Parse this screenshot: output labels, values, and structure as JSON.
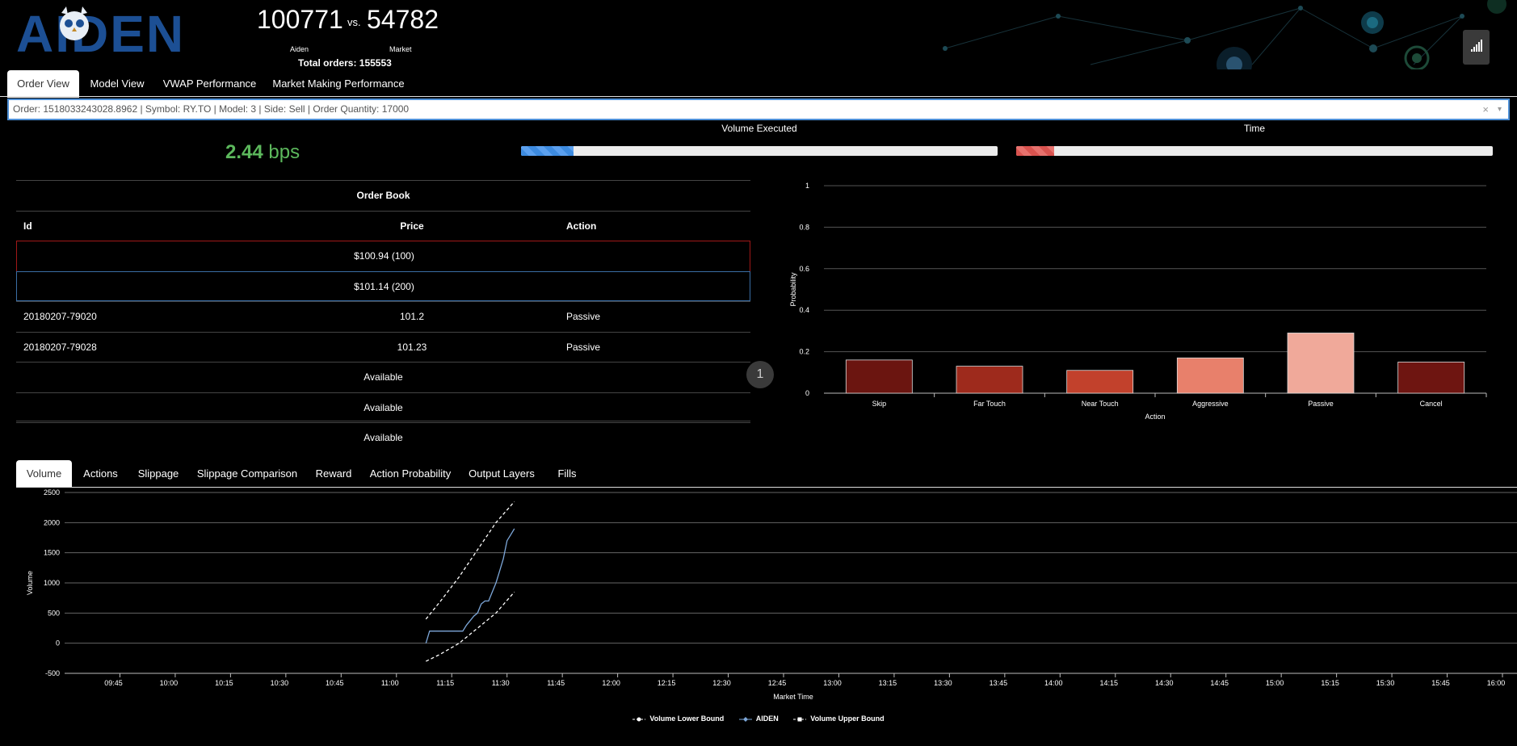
{
  "header": {
    "logo_text": "AIDEN",
    "aiden_score": "100771",
    "vs_label": "vs.",
    "market_score": "54782",
    "aiden_label": "Aiden",
    "market_label": "Market",
    "total_orders_label": "Total orders: 155553",
    "signal_icon": "signal-bars-icon"
  },
  "tabs": [
    {
      "label": "Order View",
      "active": true
    },
    {
      "label": "Model View",
      "active": false
    },
    {
      "label": "VWAP Performance",
      "active": false
    },
    {
      "label": "Market Making Performance",
      "active": false
    }
  ],
  "order_select": {
    "value": "Order: 1518033243028.8962 | Symbol: RY.TO | Model: 3 | Side: Sell | Order Quantity: 17000",
    "clear": "×",
    "caret": "▾"
  },
  "progress": {
    "volume_label": "Volume Executed",
    "volume_fraction": 0.11,
    "time_label": "Time",
    "time_fraction": 0.08
  },
  "bps": {
    "value": "2.44",
    "unit": "bps"
  },
  "order_book": {
    "title": "Order Book",
    "headers": {
      "id": "Id",
      "price": "Price",
      "action": "Action"
    },
    "ask": "$100.94 (100)",
    "bid": "$101.14 (200)",
    "rows": [
      {
        "id": "20180207-79020",
        "price": "101.2",
        "action": "Passive"
      },
      {
        "id": "20180207-79028",
        "price": "101.23",
        "action": "Passive"
      }
    ],
    "available": [
      "Available",
      "Available",
      "Available"
    ]
  },
  "page_badge": "1",
  "bottom_tabs": [
    {
      "label": "Volume",
      "active": true
    },
    {
      "label": "Actions",
      "active": false
    },
    {
      "label": "Slippage",
      "active": false
    },
    {
      "label": "Slippage Comparison",
      "active": false
    },
    {
      "label": "Reward",
      "active": false
    },
    {
      "label": "Action Probability",
      "active": false
    },
    {
      "label": "Output Layers",
      "active": false
    },
    {
      "label": "Fills",
      "active": false
    }
  ],
  "chart_data": [
    {
      "type": "bar",
      "categories": [
        "Skip",
        "Far Touch",
        "Near Touch",
        "Aggressive",
        "Passive",
        "Cancel"
      ],
      "values": [
        0.16,
        0.13,
        0.11,
        0.17,
        0.29,
        0.15
      ],
      "bar_colors": [
        "#6b1510",
        "#9e2a1c",
        "#c2412c",
        "#e8806b",
        "#f0a99a",
        "#6e1511"
      ],
      "xlabel": "Action",
      "ylabel": "Probability",
      "ylim": [
        0,
        1
      ],
      "yticks": [
        "0",
        "0.2",
        "0.4",
        "0.6",
        "0.8",
        "1"
      ],
      "grid": true
    },
    {
      "type": "line",
      "xlabel": "Market Time",
      "ylabel": "Volume",
      "x_ticks": [
        "09:45",
        "10:00",
        "10:15",
        "10:30",
        "10:45",
        "11:00",
        "11:15",
        "11:30",
        "11:45",
        "12:00",
        "12:15",
        "12:30",
        "12:45",
        "13:00",
        "13:15",
        "13:30",
        "13:45",
        "14:00",
        "14:15",
        "14:30",
        "14:45",
        "15:00",
        "15:15",
        "15:30",
        "15:45",
        "16:00"
      ],
      "y_ticks": [
        "2500",
        "2000",
        "1500",
        "1000",
        "500",
        "0",
        "-500"
      ],
      "ylim": [
        -500,
        2500
      ],
      "grid": true,
      "series": [
        {
          "name": "Volume Lower Bound",
          "color": "#ffffff",
          "dashed": true,
          "points": [
            [
              "11:08",
              -300
            ],
            [
              "11:12",
              -180
            ],
            [
              "11:17",
              0
            ],
            [
              "11:22",
              250
            ],
            [
              "11:27",
              500
            ],
            [
              "11:32",
              850
            ]
          ]
        },
        {
          "name": "AIDEN",
          "color": "#7da7d9",
          "dashed": false,
          "points": [
            [
              "11:08",
              0
            ],
            [
              "11:09",
              200
            ],
            [
              "11:13",
              200
            ],
            [
              "11:16",
              200
            ],
            [
              "11:18",
              200
            ],
            [
              "11:19",
              300
            ],
            [
              "11:21",
              450
            ],
            [
              "11:22",
              500
            ],
            [
              "11:23",
              650
            ],
            [
              "11:24",
              700
            ],
            [
              "11:25",
              700
            ],
            [
              "11:26",
              850
            ],
            [
              "11:27",
              1000
            ],
            [
              "11:28",
              1200
            ],
            [
              "11:29",
              1400
            ],
            [
              "11:30",
              1700
            ],
            [
              "11:31",
              1800
            ],
            [
              "11:32",
              1900
            ]
          ]
        },
        {
          "name": "Volume Upper Bound",
          "color": "#ffffff",
          "dashed": true,
          "points": [
            [
              "11:08",
              400
            ],
            [
              "11:12",
              700
            ],
            [
              "11:17",
              1100
            ],
            [
              "11:22",
              1550
            ],
            [
              "11:27",
              2000
            ],
            [
              "11:32",
              2350
            ]
          ]
        }
      ]
    }
  ]
}
